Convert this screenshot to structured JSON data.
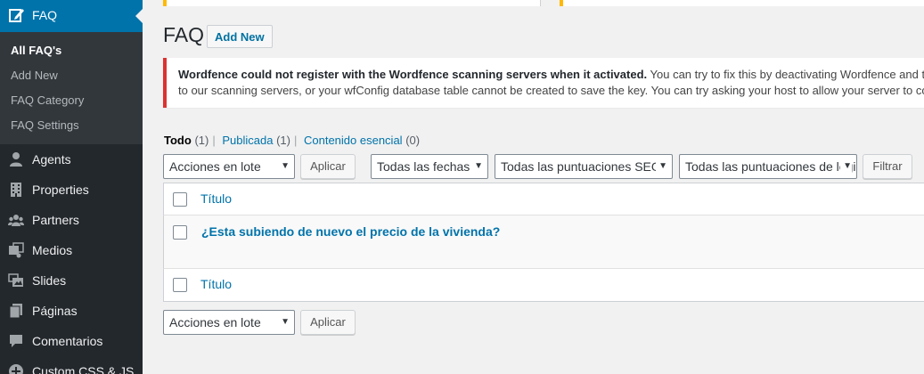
{
  "sidebar": {
    "current_menu": {
      "label": "FAQ",
      "icon": "edit-icon"
    },
    "submenu": [
      {
        "label": "All FAQ's",
        "current": true
      },
      {
        "label": "Add New"
      },
      {
        "label": "FAQ Category"
      },
      {
        "label": "FAQ Settings"
      }
    ],
    "items": [
      {
        "label": "Agents",
        "icon": "user-icon"
      },
      {
        "label": "Properties",
        "icon": "building-icon"
      },
      {
        "label": "Partners",
        "icon": "groups-icon"
      },
      {
        "label": "Medios",
        "icon": "media-icon"
      },
      {
        "label": "Slides",
        "icon": "slides-icon"
      },
      {
        "label": "Páginas",
        "icon": "page-icon"
      },
      {
        "label": "Comentarios",
        "icon": "comment-icon"
      },
      {
        "label": "Custom CSS & JS",
        "icon": "plus-circle-icon"
      }
    ]
  },
  "header": {
    "title": "FAQ",
    "add_new_label": "Add New"
  },
  "notice": {
    "bold": "Wordfence could not register with the Wordfence scanning servers when it activated.",
    "line1_rest": " You can try to fix this by deactivating Wordfence and then a",
    "line2": "to our scanning servers, or your wfConfig database table cannot be created to save the key. You can try asking your host to allow your server to co"
  },
  "views": [
    {
      "label": "Todo",
      "count": "(1)",
      "current": true
    },
    {
      "label": "Publicada",
      "count": "(1)"
    },
    {
      "label": "Contenido esencial",
      "count": "(0)"
    }
  ],
  "filters": {
    "bulk_actions": "Acciones en lote",
    "apply": "Aplicar",
    "dates": "Todas las fechas",
    "seo_scores": "Todas las puntuaciones SEO",
    "readability_scores": "Todas las puntuaciones de legibilidad",
    "filter": "Filtrar"
  },
  "table": {
    "column_title": "Título",
    "rows": [
      {
        "title": "¿Esta subiendo de nuevo el precio de la vivienda?"
      }
    ]
  },
  "bottom_actions": {
    "bulk_actions": "Acciones en lote",
    "apply": "Aplicar"
  },
  "colors": {
    "sidebar_bg": "#23282d",
    "submenu_bg": "#32373c",
    "accent": "#0073aa",
    "error": "#dc3232",
    "warning": "#ffb900"
  }
}
